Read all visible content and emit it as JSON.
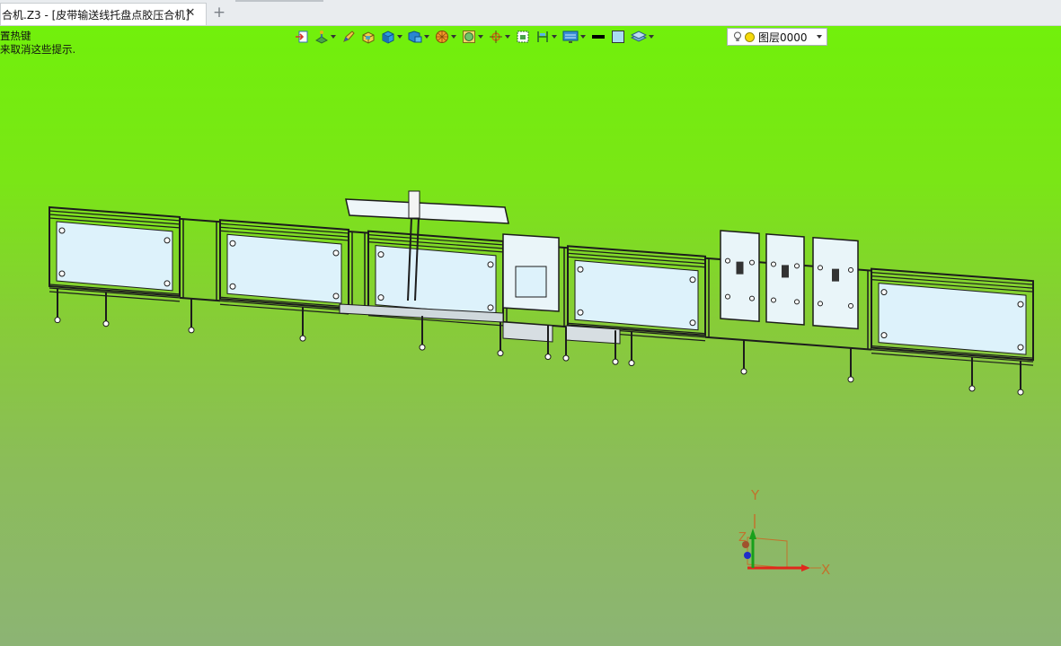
{
  "tab": {
    "title": "合机.Z3 - [皮带输送线托盘点胶压合机]",
    "close_glyph": "✕",
    "add_glyph": "+"
  },
  "hint": {
    "line1": "置热键",
    "line2": "来取消这些提示."
  },
  "toolbar": {
    "icons": [
      "import-icon",
      "sketch-plane-icon",
      "pencil-icon",
      "solid-box-icon",
      "cube-icon",
      "shaded-display-icon",
      "sphere-render-icon",
      "material-icon",
      "pivot-icon",
      "fit-view-icon",
      "section-icon",
      "display-settings-icon",
      "line-color-icon",
      "fill-color-icon",
      "layer-stack-icon"
    ],
    "layer_name": "图层0000"
  },
  "axes": {
    "x_label": "X",
    "y_label": "Y",
    "z_label": "Z"
  },
  "colors": {
    "background_top": "#71f00b",
    "background_bottom": "#8cb474",
    "panel_fill": "#ddf2fb",
    "frame_line": "#1c1c1c",
    "axis_x": "#e0281c",
    "axis_y": "#18a01b",
    "axis_z": "#1f2ec9",
    "axis_label": "#c2722c"
  }
}
